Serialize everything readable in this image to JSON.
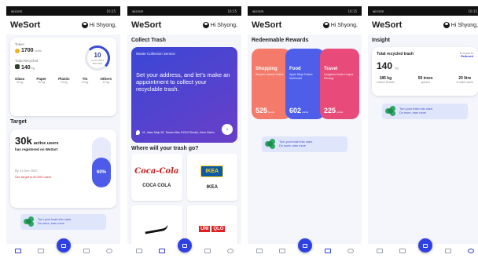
{
  "status_time": "10:15",
  "status_left": "wisrom",
  "app": {
    "brand": "WeSort",
    "greeting": "Hi Shyong,"
  },
  "screen1": {
    "token_label": "Token",
    "token_value": "1700",
    "token_unit": "coins",
    "recycled_label": "Total Recycled",
    "recycled_value": "140",
    "recycled_unit": "kg",
    "ring_value": "10",
    "ring_caption": "Level\nSORT MASTER",
    "bins": [
      {
        "name": "Glass",
        "amount": "30 kg"
      },
      {
        "name": "Paper",
        "amount": "30 kg"
      },
      {
        "name": "Plastic",
        "amount": "24 kg"
      },
      {
        "name": "Tin",
        "amount": "10 kg"
      },
      {
        "name": "Others",
        "amount": "10 kg"
      }
    ],
    "target_title": "Target",
    "active_users_value": "30k",
    "active_users_label": "active users",
    "registered_text": "has registered on WeSort",
    "target_date": "By 31 Dec 2020",
    "target_goal": "Our target is 50,000 users",
    "progress_percent": 60,
    "progress_label": "60%"
  },
  "promo": {
    "line1": "Turn your trash into cash.",
    "line2": "Do more, earn more"
  },
  "screen2": {
    "section_title": "Collect Trash",
    "service_label": "Waste Collection Service",
    "headline": "Set your address, and let's make an appointment to collect your recyclable trash.",
    "address": "11, Jalan Maju 25, Taman Mas, 81310 Skudai, Johor Bahru",
    "brands_title": "Where will your trash go?",
    "brands": [
      {
        "name": "COCA COLA",
        "logo": "Coca-Cola"
      },
      {
        "name": "IKEA",
        "logo": "IKEA"
      },
      {
        "name": "",
        "logo": "nike-swoosh"
      },
      {
        "name": "",
        "logo": "UNIQLO"
      }
    ]
  },
  "screen3": {
    "section_title": "Redeemable Rewards",
    "rewards": [
      {
        "title": "Shopping",
        "desc": "Shopee Lazada Zalora",
        "points": "525",
        "unit": "points",
        "color": "#f47b6b"
      },
      {
        "title": "Food",
        "desc": "Apple Ninja Tealive McDonald",
        "points": "602",
        "unit": "points",
        "color": "#4e5ee9"
      },
      {
        "title": "Travel",
        "desc": "Langkawi Kuala Lumpur Penang",
        "points": "225",
        "unit": "points",
        "color": "#e84b7a"
      }
    ]
  },
  "screen4": {
    "section_title": "Insight",
    "total_label": "Total recycled trash",
    "total_value": "140",
    "total_unit": "kg",
    "equal_label": "is equal to",
    "equal_value": "Reduced",
    "stats": [
      {
        "value": "185 kg",
        "label": "Carbon Dioxide"
      },
      {
        "value": "50 trees",
        "label": "planted"
      },
      {
        "value": "20 litre",
        "label": "of water saved"
      }
    ]
  }
}
